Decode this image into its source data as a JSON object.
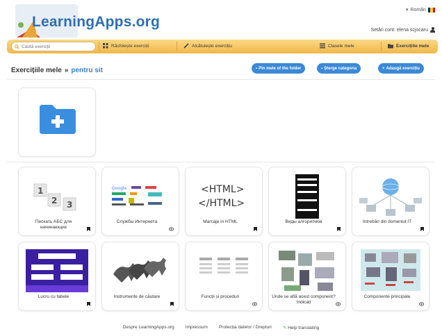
{
  "header": {
    "site_name": "LearningApps.org",
    "language": "Român",
    "account_text": "Setări cont: elena scjocaru",
    "flag_colors": [
      "#002b7f",
      "#fcd116",
      "#ce1126"
    ]
  },
  "nav": {
    "search_placeholder": "Caută exerciții",
    "browse": "Răsfoiește exerciții",
    "create": "Alcătuiește exercițiu",
    "classes": "Clasele mele",
    "my_exercises": "Exercițiile mele"
  },
  "toolbar": {
    "title": "Exercițiile mele",
    "separator": "»",
    "subfolder": "pentru sit",
    "btn_move": "Pin mele of the folder",
    "btn_delete": "Șterge categoria",
    "btn_add": "Adaugă exercițiu"
  },
  "apps": [
    {
      "label": "Пескать АБС для начинающих",
      "icon": "bookmark-icon"
    },
    {
      "label": "Службы Интернета",
      "icon": "eye-icon"
    },
    {
      "label": "Marcaje in HTML",
      "icon": "bookmark-icon"
    },
    {
      "label": "Виды алгоритмов",
      "icon": "bookmark-icon"
    },
    {
      "label": "Întrebări din domeniul IT",
      "icon": "bookmark-icon"
    },
    {
      "label": "Lucru cu tabele",
      "icon": "bookmark-icon"
    },
    {
      "label": "Instrumente de căutare",
      "icon": "bookmark-icon"
    },
    {
      "label": "Funcții și proceduri",
      "icon": "eye-icon"
    },
    {
      "label": "Unde se află acest component? Indicați",
      "icon": "eye-icon"
    },
    {
      "label": "Componente principale",
      "icon": "eye-icon"
    }
  ],
  "thumb_text": {
    "html_open": "<HTML>",
    "html_close": "</HTML>",
    "numbers": [
      "1",
      "2",
      "3"
    ],
    "google": "Google"
  },
  "footer": {
    "about": "Despre LearningApps.org",
    "impressum": "Impressum",
    "privacy": "Protecția datelor / Drepturi",
    "help": "Help translating"
  },
  "colors": {
    "accent": "#3b89d6",
    "nav": "#f4c35c",
    "logo": "#2d6fb4"
  }
}
